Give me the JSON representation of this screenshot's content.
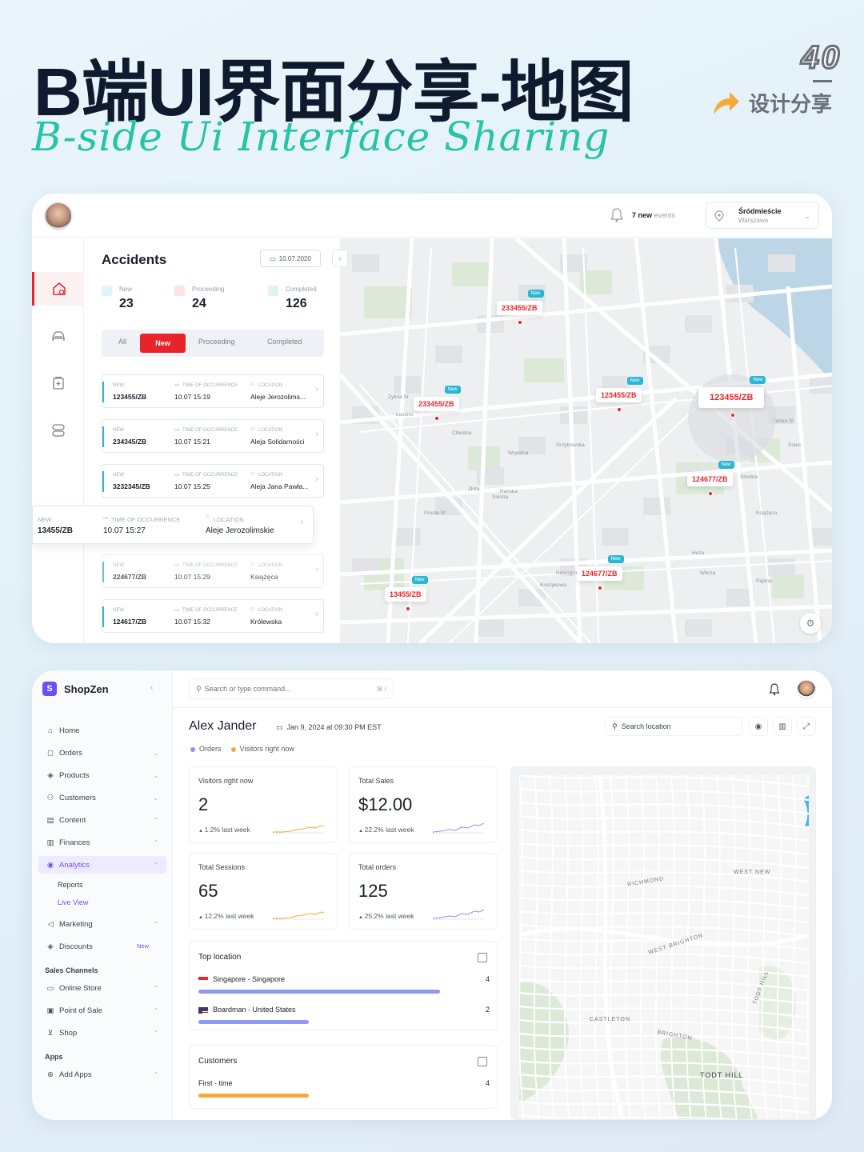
{
  "header": {
    "title": "B端UI界面分享-地图",
    "subtitle": "B-side Ui Interface Sharing",
    "issue_number": "40",
    "share_label": "设计分享",
    "accent_color": "#27c3a4"
  },
  "accidents_app": {
    "topbar": {
      "events_count": "7 new",
      "events_suffix": "events",
      "location_name": "Śródmieście",
      "location_city": "Warszawa"
    },
    "title": "Accidents",
    "date": "10.07.2020",
    "stats": [
      {
        "label": "New",
        "value": "23",
        "color": "#2bb7d4"
      },
      {
        "label": "Proceeding",
        "value": "24",
        "color": "#e8242b"
      },
      {
        "label": "Completed",
        "value": "126",
        "color": "#3cc06a"
      }
    ],
    "filters": [
      "All",
      "New",
      "Proceeding",
      "Completed"
    ],
    "active_filter": "New",
    "labels": {
      "status": "NEW",
      "time": "TIME OF OCCURRENCE",
      "location": "LOCATION"
    },
    "items": [
      {
        "id": "123455/ZB",
        "time": "10.07 15:19",
        "location": "Aleje Jerozolims..."
      },
      {
        "id": "234345/ZB",
        "time": "10.07 15:21",
        "location": "Aleja Solidarności"
      },
      {
        "id": "3232345/ZB",
        "time": "10.07 15:25",
        "location": "Aleja Jana Pawła..."
      },
      {
        "id": "13455/ZB",
        "time": "10.07 15:27",
        "location": "Aleje Jerozolimskie"
      },
      {
        "id": "224677/ZB",
        "time": "10.07 15:29",
        "location": "Książęca"
      },
      {
        "id": "124617/ZB",
        "time": "10.07 15:32",
        "location": "Królewska"
      }
    ],
    "map_badge": "New",
    "markers": [
      "233455/ZB",
      "233455/ZB",
      "123455/ZB",
      "123455/ZB",
      "124677/ZB",
      "124677/ZB",
      "13455/ZB"
    ],
    "streets": [
      "Zytnia St",
      "Chłodna",
      "Grzybowska",
      "Prosta St",
      "Złota",
      "Sienna",
      "Pańska",
      "Wspólna",
      "Koszykowa",
      "Książęca",
      "Piękna",
      "Tamka St",
      "Solec",
      "Nowogrodzka",
      "Hoża",
      "Wilcza",
      "Leszno",
      "Smolna"
    ]
  },
  "shopzen": {
    "brand": "ShopZen",
    "logo_letter": "S",
    "search_placeholder": "Search or type command...",
    "search_shortcut": "⌘ /",
    "nav": [
      {
        "label": "Home",
        "icon": "home-icon"
      },
      {
        "label": "Orders",
        "icon": "bag-icon",
        "chev": "⌄"
      },
      {
        "label": "Products",
        "icon": "tag-icon",
        "chev": "⌄"
      },
      {
        "label": "Customers",
        "icon": "user-icon",
        "chev": "⌄"
      },
      {
        "label": "Content",
        "icon": "doc-icon",
        "chev": "⌃"
      },
      {
        "label": "Finances",
        "icon": "bank-icon",
        "chev": "⌃"
      },
      {
        "label": "Analytics",
        "icon": "chart-icon",
        "chev": "⌃"
      }
    ],
    "analytics_sub": [
      "Reports",
      "Live View"
    ],
    "nav2": [
      {
        "label": "Marketing",
        "icon": "megaphone-icon",
        "chev": "⌃"
      },
      {
        "label": "Discounts",
        "icon": "discount-icon",
        "badge": "New"
      }
    ],
    "sales_channels_title": "Sales Channels",
    "sales_channels": [
      {
        "label": "Online Store",
        "icon": "store-icon",
        "chev": "⌃"
      },
      {
        "label": "Point of Sale",
        "icon": "pos-icon",
        "chev": "⌃"
      },
      {
        "label": "Shop",
        "icon": "cart-icon",
        "chev": "⌃"
      }
    ],
    "apps_title": "Apps",
    "apps": [
      {
        "label": "Add Apps",
        "icon": "plus-icon",
        "chev": "⌃"
      }
    ],
    "user_name": "Alex Jander",
    "datetime": "Jan 9, 2024 at 09:30 PM EST",
    "legend": [
      {
        "label": "Orders",
        "color": "#8e8ef6"
      },
      {
        "label": "Visitors right now",
        "color": "#f7a83b"
      }
    ],
    "search_location": "Search location",
    "kpis": [
      {
        "label": "Visitors right now",
        "value": "2",
        "delta": "1.2% last week",
        "spark_color": "#f7a83b"
      },
      {
        "label": "Total Sales",
        "value": "$12.00",
        "delta": "22.2% last week",
        "spark_color": "#8e8ef6"
      },
      {
        "label": "Total Sessions",
        "value": "65",
        "delta": "12.2% last week",
        "spark_color": "#f7a83b"
      },
      {
        "label": "Total orders",
        "value": "125",
        "delta": "25.2% last week",
        "spark_color": "#8e8ef6"
      }
    ],
    "top_location": {
      "title": "Top location",
      "rows": [
        {
          "name": "Singapore - Singapore",
          "value": "4",
          "share": 0.83,
          "flag": "sg"
        },
        {
          "name": "Boardman - United States",
          "value": "2",
          "share": 0.38,
          "flag": "us"
        }
      ],
      "bar_color": "#8e9af6"
    },
    "customers": {
      "title": "Customers",
      "rows": [
        {
          "name": "First - time",
          "value": "4",
          "share": 0.38
        }
      ],
      "bar_color": "#f7a83b"
    },
    "map_labels": [
      "WEST NEW",
      "RICHMOND",
      "WEST BRIGHTON",
      "CASTLETON",
      "BRIGHTON",
      "TODT HILL",
      "TODT HILL"
    ]
  }
}
